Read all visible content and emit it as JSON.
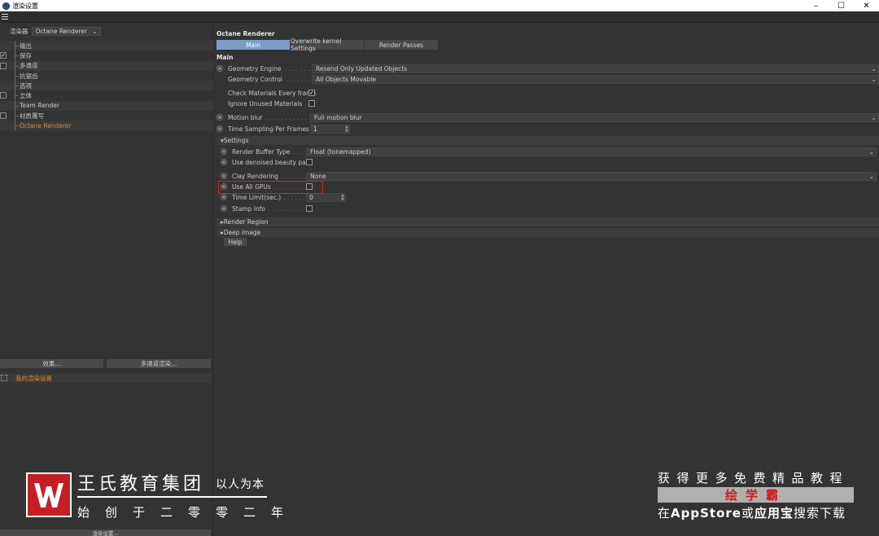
{
  "window": {
    "title": "渲染设置",
    "min": "–",
    "max": "☐",
    "close": "✕"
  },
  "left": {
    "renderer_label": "渲染器",
    "renderer_value": "Octane Renderer",
    "tree": [
      {
        "label": "输出",
        "checkbox": "none",
        "active": false
      },
      {
        "label": "保存",
        "checkbox": "checked",
        "active": false
      },
      {
        "label": "多通道",
        "checkbox": "unchecked",
        "active": false
      },
      {
        "label": "抗锯齿",
        "checkbox": "none",
        "active": false
      },
      {
        "label": "选项",
        "checkbox": "none",
        "active": false
      },
      {
        "label": "立体",
        "checkbox": "unchecked",
        "active": false
      },
      {
        "label": "Team Render",
        "checkbox": "none",
        "active": false
      },
      {
        "label": "材质覆写",
        "checkbox": "unchecked",
        "active": false
      },
      {
        "label": "Octane Renderer",
        "checkbox": "none",
        "active": true
      }
    ],
    "effects_button": "效果...",
    "multipass_button": "多通道渲染...",
    "my_render_setting": "我的渲染设置",
    "render_settings_button": "渲染设置..."
  },
  "right": {
    "title": "Octane Renderer",
    "tabs": [
      "Main",
      "Overwrite kernel Settings",
      "Render Passes"
    ],
    "section": "Main",
    "geometry_engine_label": "Geometry Engine",
    "geometry_engine_value": "Resend Only Updated Objects",
    "geometry_control_label": "Geometry Control",
    "geometry_control_value": "All Objects Movable",
    "check_materials_label": "Check Materials Every frame",
    "ignore_unused_label": "Ignore Unused Materials",
    "motion_blur_label": "Motion blur",
    "motion_blur_value": "Full motion blur",
    "time_sampling_label": "Time Sampling Per Frames",
    "time_sampling_value": "1",
    "settings_group": "▾Settings",
    "render_buffer_label": "Render Buffer Type",
    "render_buffer_value": "Float (tonemapped)",
    "denoised_label": "Use denoised beauty pass",
    "clay_label": "Clay Rendering",
    "clay_value": "None",
    "all_gpus_label": "Use All GPUs",
    "time_limit_label": "Time Limit(sec.)",
    "time_limit_value": "0",
    "stamp_label": "Stamp Info",
    "render_region_group": "▸Render Region",
    "deep_image_group": "▸Deep image",
    "help_button": "Help"
  },
  "watermark": {
    "company": "王氏教育集团",
    "slogan": "以人为本",
    "founded": "始创于二零零二年",
    "promo_line1": "获得更多免费精品教程",
    "promo_brand": "绘学霸",
    "promo_line3_a": "在",
    "promo_line3_b": "AppStore",
    "promo_line3_c": "或",
    "promo_line3_d": "应用宝",
    "promo_line3_e": "搜索下载"
  },
  "colors": {
    "accent_orange": "#e0892e",
    "tab_active": "#7a9ec8",
    "highlight_red": "#e02020",
    "brand_red": "#c41e24"
  }
}
